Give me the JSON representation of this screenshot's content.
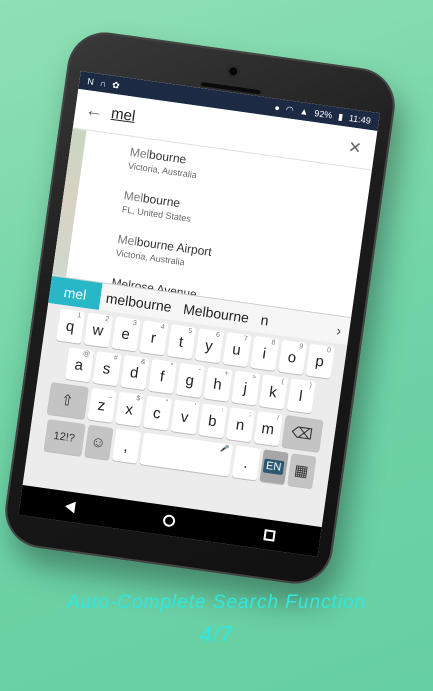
{
  "status": {
    "time": "11:49",
    "battery": "92%"
  },
  "search": {
    "value": "mel"
  },
  "results": [
    {
      "title_hl": "Mel",
      "title_rest": "bourne",
      "subtitle": "Victoria, Australia"
    },
    {
      "title_hl": "Mel",
      "title_rest": "bourne",
      "subtitle": "FL, United States"
    },
    {
      "title_hl": "Mel",
      "title_rest": "bourne Airport",
      "subtitle": "Victoria, Australia"
    },
    {
      "title_hl": "",
      "title_rest": "Melrose Avenue",
      "subtitle": ""
    }
  ],
  "suggestions": {
    "typed": "mel",
    "items": [
      "melbourne",
      "Melbourne",
      "n"
    ],
    "more": "›"
  },
  "keyboard": {
    "row1": [
      {
        "k": "q",
        "a": "1"
      },
      {
        "k": "w",
        "a": "2"
      },
      {
        "k": "e",
        "a": "3"
      },
      {
        "k": "r",
        "a": "4"
      },
      {
        "k": "t",
        "a": "5"
      },
      {
        "k": "y",
        "a": "6"
      },
      {
        "k": "u",
        "a": "7"
      },
      {
        "k": "i",
        "a": "8"
      },
      {
        "k": "o",
        "a": "9"
      },
      {
        "k": "p",
        "a": "0"
      }
    ],
    "row2": [
      {
        "k": "a",
        "a": "@"
      },
      {
        "k": "s",
        "a": "#"
      },
      {
        "k": "d",
        "a": "&"
      },
      {
        "k": "f",
        "a": "*"
      },
      {
        "k": "g",
        "a": "-"
      },
      {
        "k": "h",
        "a": "+"
      },
      {
        "k": "j",
        "a": "="
      },
      {
        "k": "k",
        "a": "("
      },
      {
        "k": "l",
        "a": ")"
      }
    ],
    "row3": [
      {
        "k": "z",
        "a": "_"
      },
      {
        "k": "x",
        "a": "$"
      },
      {
        "k": "c",
        "a": "\""
      },
      {
        "k": "v",
        "a": "'"
      },
      {
        "k": "b",
        "a": ":"
      },
      {
        "k": "n",
        "a": ";"
      },
      {
        "k": "m",
        "a": "/"
      }
    ],
    "shift": "⇧",
    "backspace": "⌫",
    "symbols": "12!?",
    "emoji": "☺",
    "comma": ",",
    "period": ".",
    "lang": "EN",
    "mic": "🎤"
  },
  "caption": {
    "line1": "Auto-Complete Search Function",
    "line2": "4/7"
  }
}
